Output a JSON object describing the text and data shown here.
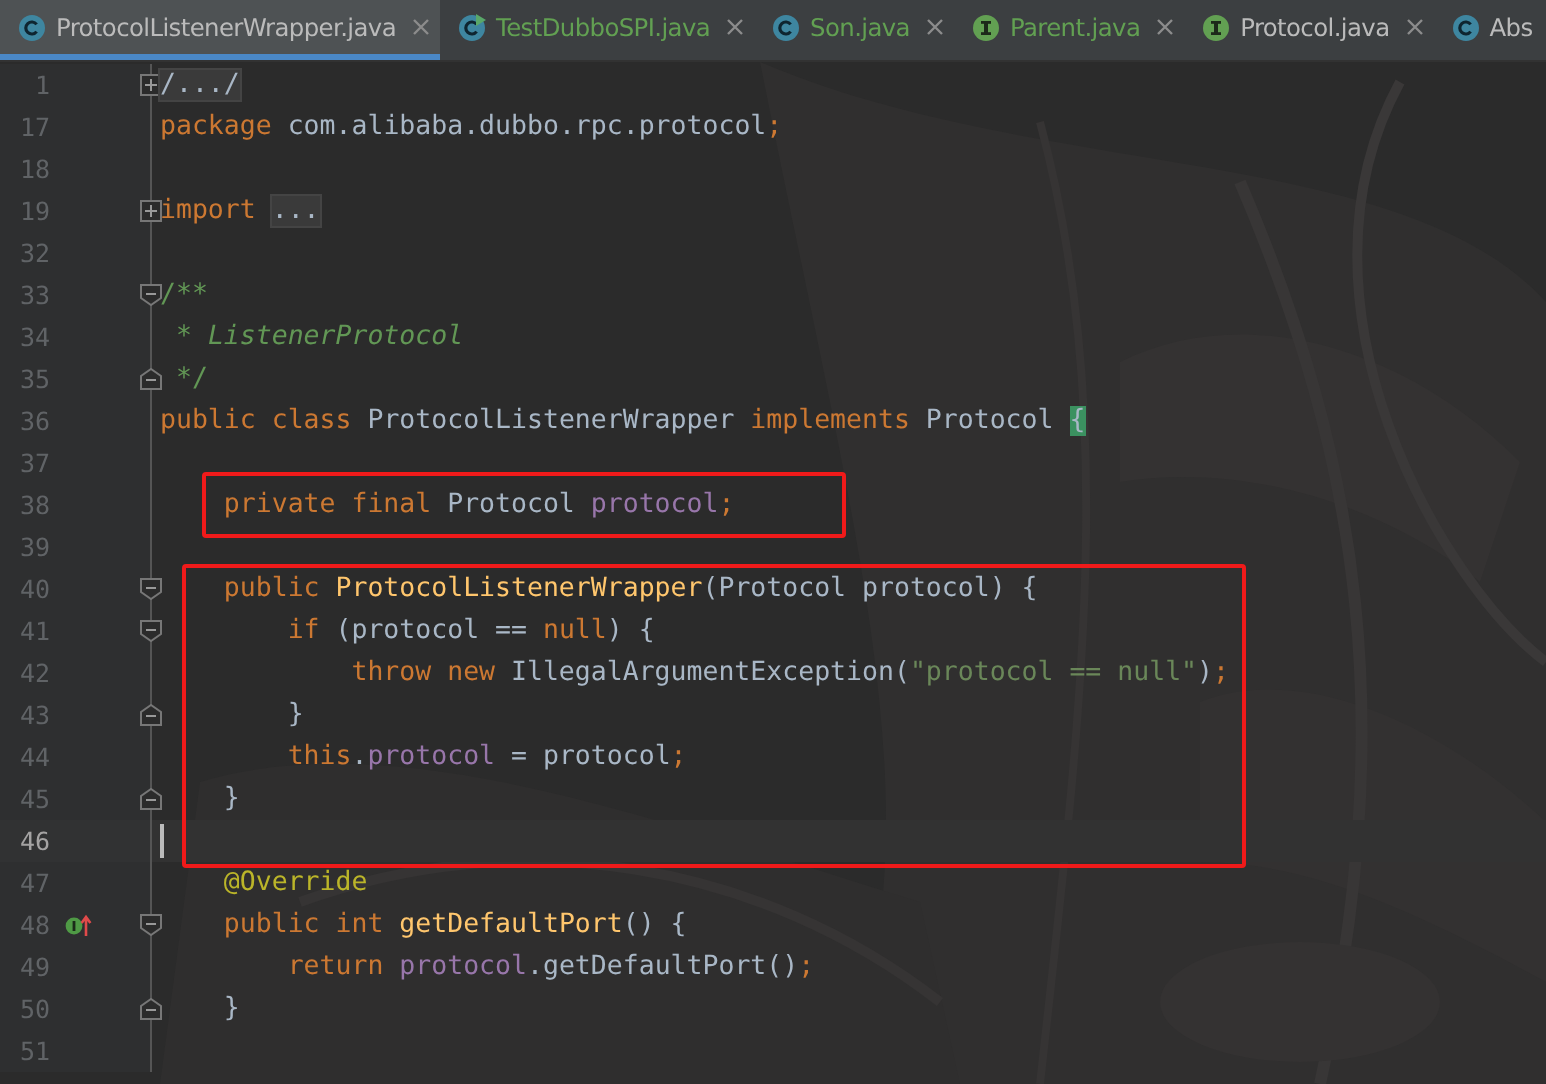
{
  "tabs": [
    {
      "label": "ProtocolListenerWrapper.java",
      "kind": "class",
      "selected": true,
      "color": "#bbbbbb",
      "closable": true
    },
    {
      "label": "TestDubboSPI.java",
      "kind": "runnable-class",
      "selected": false,
      "color": "#62a052",
      "closable": true
    },
    {
      "label": "Son.java",
      "kind": "class",
      "selected": false,
      "color": "#62a052",
      "closable": true
    },
    {
      "label": "Parent.java",
      "kind": "interface",
      "selected": false,
      "color": "#62a052",
      "closable": true
    },
    {
      "label": "Protocol.java",
      "kind": "interface",
      "selected": false,
      "color": "#bbbbbb",
      "closable": true
    },
    {
      "label": "Abs",
      "kind": "class",
      "selected": false,
      "color": "#bbbbbb",
      "closable": false
    }
  ],
  "blocks": [
    {
      "boxed": false,
      "lines": [
        {
          "number": "1",
          "kind": "folded",
          "tokens": [
            {
              "kind": "folded",
              "text": "/.../"
            }
          ]
        },
        {
          "number": "17",
          "kind": "plain",
          "tokens": [
            {
              "kind": "keyword",
              "text": "package "
            },
            {
              "kind": "plain",
              "text": "com.alibaba.dubbo.rpc.protocol"
            },
            {
              "kind": "keyword",
              "text": ";"
            }
          ]
        },
        {
          "number": "18",
          "kind": "plain"
        },
        {
          "number": "19",
          "kind": "folded",
          "tokens": [
            {
              "kind": "keyword",
              "text": "import "
            },
            {
              "kind": "folded",
              "text": "..."
            }
          ]
        },
        {
          "number": "32",
          "kind": "plain"
        },
        {
          "number": "33",
          "kind": "fold-start",
          "tokens": [
            {
              "kind": "doc",
              "text": "/**"
            }
          ]
        },
        {
          "number": "34",
          "kind": "plain",
          "tokens": [
            {
              "kind": "doc",
              "text": " * "
            },
            {
              "kind": "doctext",
              "text": "ListenerProtocol"
            }
          ]
        },
        {
          "number": "35",
          "kind": "fold-end",
          "tokens": [
            {
              "kind": "doc",
              "text": " */"
            }
          ]
        },
        {
          "number": "36",
          "kind": "plain",
          "tokens": [
            {
              "kind": "keyword",
              "text": "public class "
            },
            {
              "kind": "plain",
              "text": "ProtocolListenerWrapper "
            },
            {
              "kind": "keyword",
              "text": "implements "
            },
            {
              "kind": "plain",
              "text": "Protocol "
            },
            {
              "kind": "brace",
              "text": "{"
            }
          ]
        },
        {
          "number": "37",
          "kind": "plain"
        }
      ]
    },
    {
      "boxed": true,
      "lines": [
        {
          "number": "38",
          "kind": "plain",
          "tokens": [
            {
              "kind": "keyword",
              "text": "    private final "
            },
            {
              "kind": "plain",
              "text": "Protocol "
            },
            {
              "kind": "field",
              "text": "protocol"
            },
            {
              "kind": "keyword",
              "text": ";"
            }
          ]
        }
      ]
    },
    {
      "boxed": false,
      "lines": [
        {
          "number": "39",
          "kind": "plain"
        }
      ]
    },
    {
      "boxed": true,
      "lines": [
        {
          "number": "40",
          "kind": "fold-start",
          "tokens": [
            {
              "kind": "keyword",
              "text": "    public "
            },
            {
              "kind": "method",
              "text": "ProtocolListenerWrapper"
            },
            {
              "kind": "plain",
              "text": "(Protocol protocol) {"
            }
          ]
        },
        {
          "number": "41",
          "kind": "fold-start",
          "tokens": [
            {
              "kind": "keyword",
              "text": "        if "
            },
            {
              "kind": "plain",
              "text": "(protocol == "
            },
            {
              "kind": "keyword",
              "text": "null"
            },
            {
              "kind": "plain",
              "text": ") {"
            }
          ]
        },
        {
          "number": "42",
          "kind": "plain",
          "tokens": [
            {
              "kind": "keyword",
              "text": "            throw new "
            },
            {
              "kind": "plain",
              "text": "IllegalArgumentException("
            },
            {
              "kind": "string",
              "text": "\"protocol == null\""
            },
            {
              "kind": "plain",
              "text": ")"
            },
            {
              "kind": "keyword",
              "text": ";"
            }
          ]
        },
        {
          "number": "43",
          "kind": "fold-end",
          "tokens": [
            {
              "kind": "plain",
              "text": "        }"
            }
          ]
        },
        {
          "number": "44",
          "kind": "plain",
          "tokens": [
            {
              "kind": "keyword",
              "text": "        this"
            },
            {
              "kind": "plain",
              "text": "."
            },
            {
              "kind": "field",
              "text": "protocol"
            },
            {
              "kind": "plain",
              "text": " = protocol"
            },
            {
              "kind": "keyword",
              "text": ";"
            }
          ]
        },
        {
          "number": "45",
          "kind": "fold-end",
          "tokens": [
            {
              "kind": "plain",
              "text": "    }"
            }
          ]
        },
        {
          "number": "46",
          "kind": "plain",
          "current": true
        }
      ]
    },
    {
      "boxed": false,
      "lines": [
        {
          "number": "47",
          "kind": "plain",
          "tokens": [
            {
              "kind": "annotation",
              "text": "    @Override"
            }
          ]
        },
        {
          "number": "48",
          "kind": "fold-start",
          "implements": true,
          "tokens": [
            {
              "kind": "keyword",
              "text": "    public int "
            },
            {
              "kind": "method",
              "text": "getDefaultPort"
            },
            {
              "kind": "plain",
              "text": "() {"
            }
          ]
        },
        {
          "number": "49",
          "kind": "plain",
          "tokens": [
            {
              "kind": "keyword",
              "text": "        return "
            },
            {
              "kind": "field",
              "text": "protocol"
            },
            {
              "kind": "plain",
              "text": ".getDefaultPort()"
            },
            {
              "kind": "keyword",
              "text": ";"
            }
          ]
        },
        {
          "number": "50",
          "kind": "fold-end",
          "tokens": [
            {
              "kind": "plain",
              "text": "    }"
            }
          ]
        },
        {
          "number": "51",
          "kind": "plain"
        }
      ]
    }
  ]
}
